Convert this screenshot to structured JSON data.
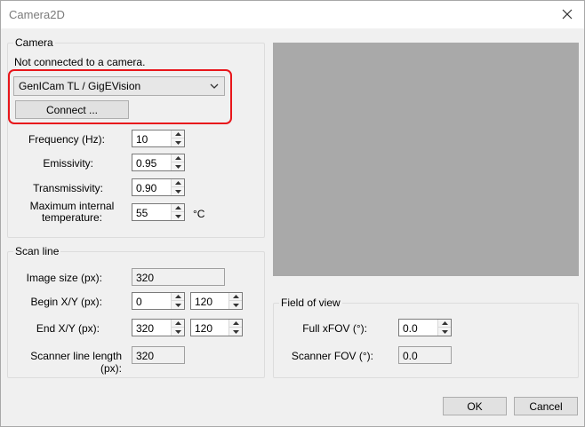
{
  "window": {
    "title": "Camera2D"
  },
  "camera": {
    "group_label": "Camera",
    "status": "Not connected to a camera.",
    "interface_selected": "GenICam TL / GigEVision",
    "connect_label": "Connect ...",
    "frequency_label": "Frequency (Hz):",
    "frequency_value": "10",
    "emissivity_label": "Emissivity:",
    "emissivity_value": "0.95",
    "transmissivity_label": "Transmissivity:",
    "transmissivity_value": "0.90",
    "max_temp_label_line1": "Maximum internal",
    "max_temp_label_line2": "temperature:",
    "max_temp_value": "55",
    "max_temp_unit": "°C"
  },
  "scan_line": {
    "group_label": "Scan line",
    "image_size_label": "Image size (px):",
    "image_size_value": "320",
    "begin_label": "Begin X/Y (px):",
    "begin_x": "0",
    "begin_y": "120",
    "end_label": "End X/Y (px):",
    "end_x": "320",
    "end_y": "120",
    "scanner_length_label": "Scanner line length (px):",
    "scanner_length_value": "320"
  },
  "fov": {
    "group_label": "Field of view",
    "full_xfov_label": "Full xFOV (°):",
    "full_xfov_value": "0.0",
    "scanner_fov_label": "Scanner FOV (°):",
    "scanner_fov_value": "0.0"
  },
  "buttons": {
    "ok": "OK",
    "cancel": "Cancel"
  },
  "colors": {
    "highlight": "#e8161b",
    "preview": "#a9a9a9"
  }
}
